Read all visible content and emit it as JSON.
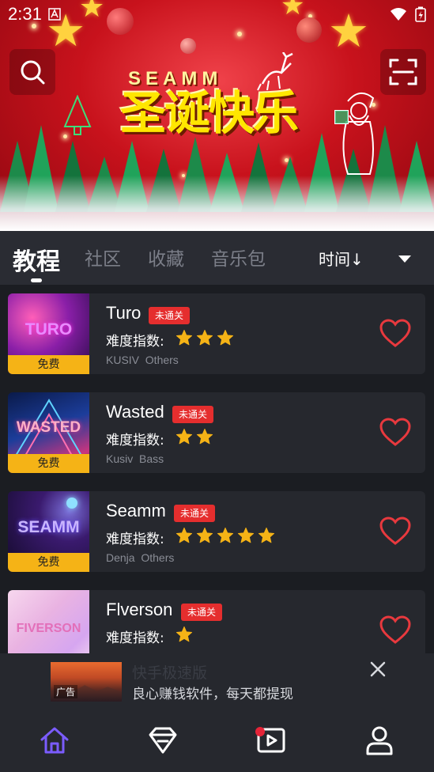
{
  "status_bar": {
    "time": "2:31"
  },
  "banner": {
    "title_en": "SEAMM",
    "title_cn": "圣诞快乐"
  },
  "tabs": {
    "items": [
      {
        "label": "教程",
        "active": true
      },
      {
        "label": "社区",
        "active": false
      },
      {
        "label": "收藏",
        "active": false
      },
      {
        "label": "音乐包",
        "active": false
      }
    ],
    "sort_label": "时间↓"
  },
  "songs": [
    {
      "name": "Turo",
      "cover_text": "TURO",
      "free_tag": "免费",
      "badge": "未通关",
      "difficulty_label": "难度指数:",
      "difficulty": 3,
      "artist": "KUSIV  Others"
    },
    {
      "name": "Wasted",
      "cover_text": "WASTED",
      "free_tag": "免费",
      "badge": "未通关",
      "difficulty_label": "难度指数:",
      "difficulty": 2,
      "artist": "Kusiv  Bass"
    },
    {
      "name": "Seamm",
      "cover_text": "SEAMM",
      "free_tag": "免费",
      "badge": "未通关",
      "difficulty_label": "难度指数:",
      "difficulty": 5,
      "artist": "Denja  Others"
    },
    {
      "name": "Flverson",
      "cover_text": "FIVERSON",
      "badge": "未通关",
      "difficulty_label": "难度指数:",
      "difficulty": 1
    }
  ],
  "ad": {
    "title": "快手极速版",
    "description": "良心赚钱软件，每天都提现",
    "tag": "广告"
  },
  "bottom_nav": {
    "items": [
      {
        "icon": "home-icon",
        "active": true
      },
      {
        "icon": "diamond-icon",
        "active": false
      },
      {
        "icon": "video-icon",
        "active": false,
        "notification": true
      },
      {
        "icon": "user-icon",
        "active": false
      }
    ]
  },
  "colors": {
    "background": "#1b1d22",
    "card": "#26282e",
    "accent_red": "#e52e2e",
    "star_yellow": "#f5b316",
    "nav_active": "#7b5cff"
  }
}
